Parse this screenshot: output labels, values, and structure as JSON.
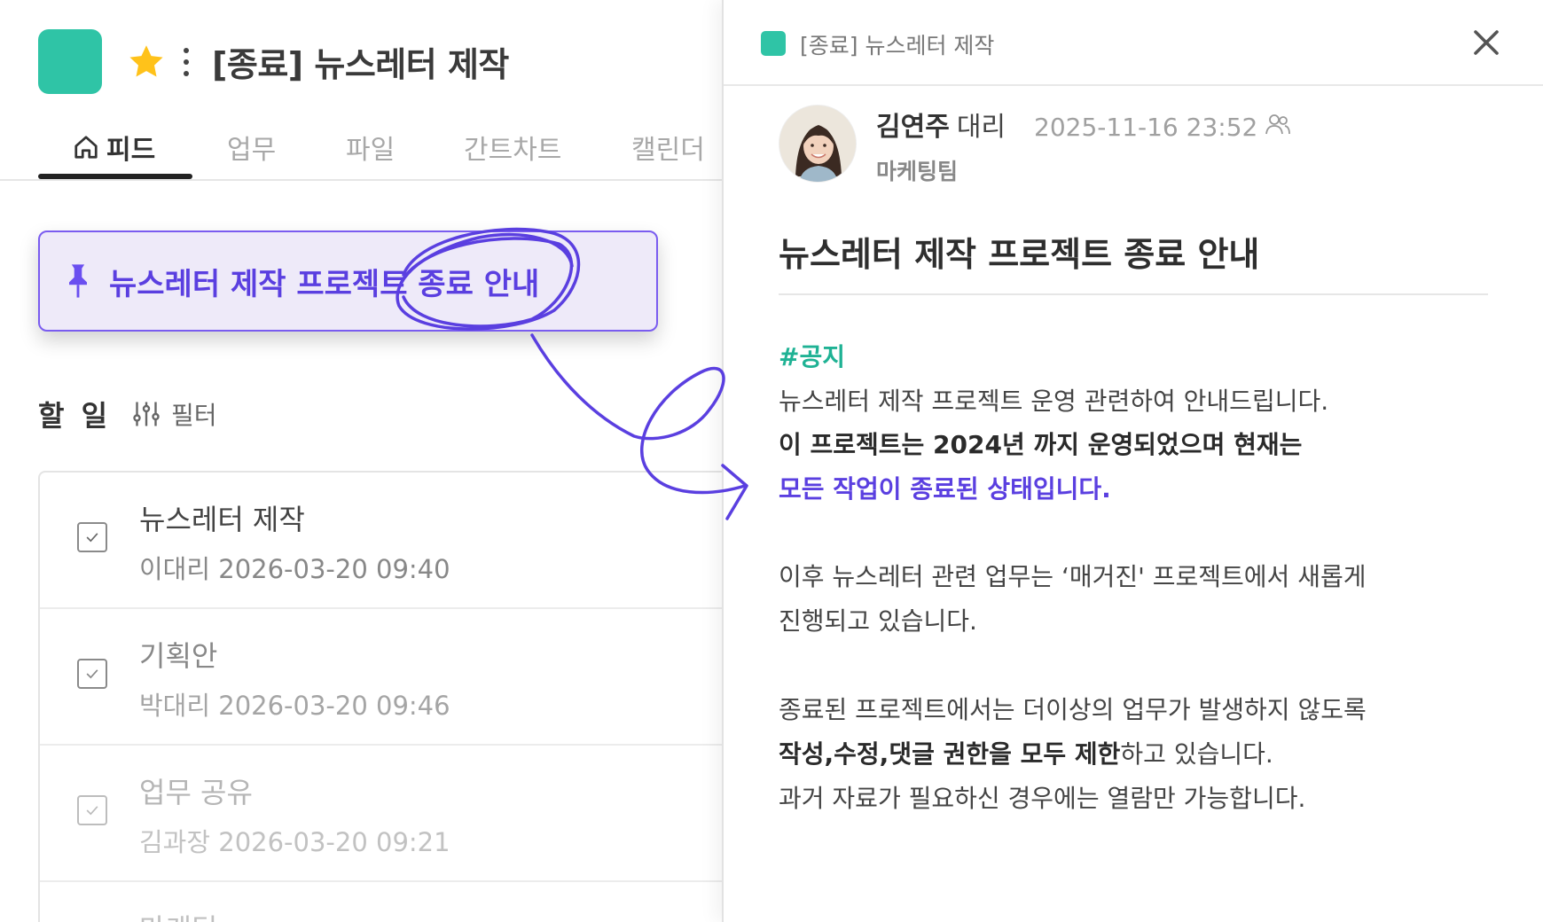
{
  "project": {
    "title": "[종료] 뉴스레터 제작",
    "color": "#2fc4a6"
  },
  "tabs": [
    {
      "label": "피드",
      "active": true
    },
    {
      "label": "업무"
    },
    {
      "label": "파일"
    },
    {
      "label": "간트차트"
    },
    {
      "label": "캘린더"
    }
  ],
  "pinned": {
    "text": "뉴스레터 제작 프로젝트 종료 안내"
  },
  "todo": {
    "title": "할 일",
    "filter_label": "필터",
    "tasks": [
      {
        "name": "뉴스레터 제작",
        "meta": "이대리 2026-03-20 09:40"
      },
      {
        "name": "기획안",
        "meta": "박대리 2026-03-20 09:46"
      },
      {
        "name": "업무 공유",
        "meta": "김과장 2026-03-20 09:21"
      },
      {
        "name": "마케팅",
        "meta": ""
      }
    ]
  },
  "post": {
    "header_title": "[종료] 뉴스레터 제작",
    "author_name": "김연주",
    "author_rank": "대리",
    "author_team": "마케팅팀",
    "date": "2025-11-16 23:52",
    "title": "뉴스레터 제작 프로젝트 종료 안내",
    "hashtag": "#공지",
    "line1": "뉴스레터 제작 프로젝트 운영 관련하여 안내드립니다.",
    "line2_bold": "이 프로젝트는 2024년 까지 운영되었으며 현재는",
    "line3_purple": "모든 작업이 종료된 상태입니다.",
    "line4": "이후 뉴스레터 관련 업무는 ‘매거진' 프로젝트에서 새롭게",
    "line5": "진행되고 있습니다.",
    "line6": "종료된 프로젝트에서는 더이상의 업무가 발생하지 않도록",
    "line7_bold": "작성,수정,댓글 권한을 모두 제한",
    "line7_rest": "하고 있습니다.",
    "line8": "과거 자료가 필요하신 경우에는 열람만 가능합니다."
  },
  "colors": {
    "accent_purple": "#5a3fe0",
    "hashtag_green": "#1fb294",
    "project_teal": "#2fc4a6"
  }
}
